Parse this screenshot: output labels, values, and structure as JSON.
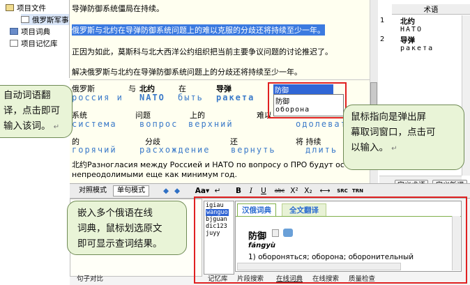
{
  "tree": {
    "items": [
      {
        "label": "项目文件"
      },
      {
        "label": "俄罗斯军事"
      },
      {
        "label": "项目词典"
      },
      {
        "label": "项目记忆库"
      }
    ]
  },
  "doc": {
    "lines": [
      "导弹防御系统僵局在持续。",
      "俄罗斯与北约在导弹防御系统问题上的难以克服的分歧还将持续至少一年。",
      "正因为如此，莫斯科与北大西洋公约组织把当前主要争议问题的讨论推迟了。",
      "解决俄罗斯与北约在导弹防御系统问题上的分歧还将持续至少一年。"
    ],
    "aligned": {
      "zh_row1": [
        "俄罗斯",
        "与",
        "北约",
        "在",
        "导弹"
      ],
      "ru_row1": [
        "россия и",
        "NATO",
        "быть",
        "ракета"
      ],
      "zh_row2": [
        "系统",
        "问题",
        "上的",
        "难以"
      ],
      "ru_row2": [
        "система",
        "вопрос",
        "верхний",
        "одолевать"
      ],
      "zh_row3": [
        "的",
        "分歧",
        "还",
        "将 持续"
      ],
      "ru_row3": [
        "горячий",
        "расхождение",
        "вернуть",
        "длить"
      ]
    },
    "translation_line1": "北约Разногласия между Россией и НАТО по вопросу о ПРО будут ост",
    "translation_line2": "непреодолимыми еще как минимум год."
  },
  "popup": {
    "field": "防御",
    "items": [
      "防御",
      "оборона"
    ]
  },
  "terms": {
    "header": "术语",
    "rows": [
      {
        "num": "1",
        "zh": "北约",
        "ru": "НАТО"
      },
      {
        "num": "2",
        "zh": "导弹",
        "ru": "ракета"
      }
    ]
  },
  "toolbar": {
    "compare_mode": "对照模式",
    "sentence_mode": "单句模式",
    "define_term": "定义术语",
    "define_new": "定义新词",
    "icons": [
      "◆",
      "◆",
      "Aa▾",
      "↵",
      "B",
      "I",
      "U",
      "abc",
      "X²",
      "X₂",
      "⟷",
      "SRC",
      "TRN"
    ]
  },
  "dict": {
    "list": [
      "igiau",
      "wanguo",
      "bjguan",
      "dic123",
      "juyy"
    ],
    "selected_index": 1,
    "tab_active": "汉俄词典",
    "tab_other": "全文翻译",
    "headword": "防御",
    "pinyin": "fángyù",
    "gloss": "1) обороняться; оборона; оборонительный"
  },
  "bottom_tabs": {
    "left": "句子对比",
    "items": [
      "记忆库",
      "片段搜索",
      "在线词典",
      "在线搜索",
      "质量检查"
    ]
  },
  "callouts": {
    "left": [
      "自动词语翻",
      "译，点击即可",
      "输入该词。"
    ],
    "right": [
      "鼠标指向是弹出屏",
      "幕取词窗口，点击可",
      "以输入。"
    ],
    "bottom": [
      "嵌入多个俄语在线",
      "词典，鼠标划选原文",
      "即可显示查词结果。"
    ],
    "return_mark": "↵"
  }
}
